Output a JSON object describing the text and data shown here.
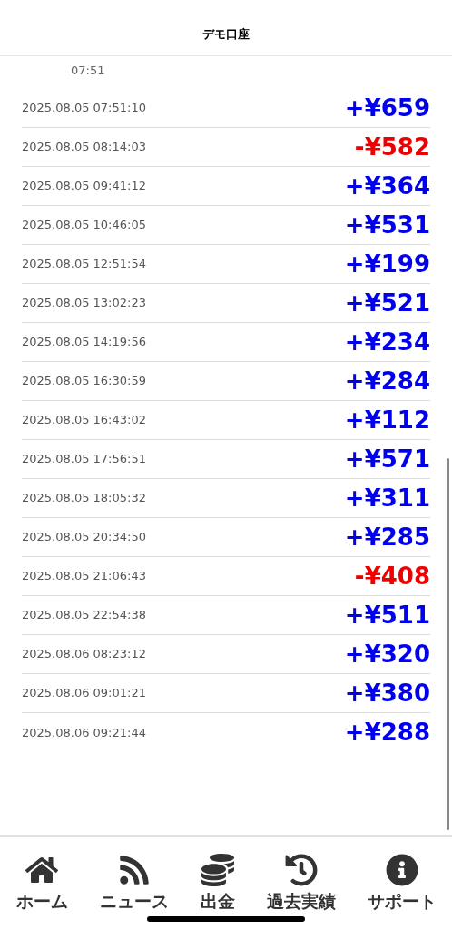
{
  "header": {
    "title": "デモ口座"
  },
  "chart_axis_labels": [
    "07:51"
  ],
  "trades": [
    {
      "time": "2025.08.05 07:51:10",
      "amount": "+¥659",
      "kind": "profit"
    },
    {
      "time": "2025.08.05 08:14:03",
      "amount": "-¥582",
      "kind": "loss"
    },
    {
      "time": "2025.08.05 09:41:12",
      "amount": "+¥364",
      "kind": "profit"
    },
    {
      "time": "2025.08.05 10:46:05",
      "amount": "+¥531",
      "kind": "profit"
    },
    {
      "time": "2025.08.05 12:51:54",
      "amount": "+¥199",
      "kind": "profit"
    },
    {
      "time": "2025.08.05 13:02:23",
      "amount": "+¥521",
      "kind": "profit"
    },
    {
      "time": "2025.08.05 14:19:56",
      "amount": "+¥234",
      "kind": "profit"
    },
    {
      "time": "2025.08.05 16:30:59",
      "amount": "+¥284",
      "kind": "profit"
    },
    {
      "time": "2025.08.05 16:43:02",
      "amount": "+¥112",
      "kind": "profit"
    },
    {
      "time": "2025.08.05 17:56:51",
      "amount": "+¥571",
      "kind": "profit"
    },
    {
      "time": "2025.08.05 18:05:32",
      "amount": "+¥311",
      "kind": "profit"
    },
    {
      "time": "2025.08.05 20:34:50",
      "amount": "+¥285",
      "kind": "profit"
    },
    {
      "time": "2025.08.05 21:06:43",
      "amount": "-¥408",
      "kind": "loss"
    },
    {
      "time": "2025.08.05 22:54:38",
      "amount": "+¥511",
      "kind": "profit"
    },
    {
      "time": "2025.08.06 08:23:12",
      "amount": "+¥320",
      "kind": "profit"
    },
    {
      "time": "2025.08.06 09:01:21",
      "amount": "+¥380",
      "kind": "profit"
    },
    {
      "time": "2025.08.06 09:21:44",
      "amount": "+¥288",
      "kind": "profit"
    }
  ],
  "tab_bar": [
    {
      "label": "ホーム"
    },
    {
      "label": "ニュース"
    },
    {
      "label": "出金"
    },
    {
      "label": "過去実績"
    },
    {
      "label": "サポート"
    }
  ]
}
